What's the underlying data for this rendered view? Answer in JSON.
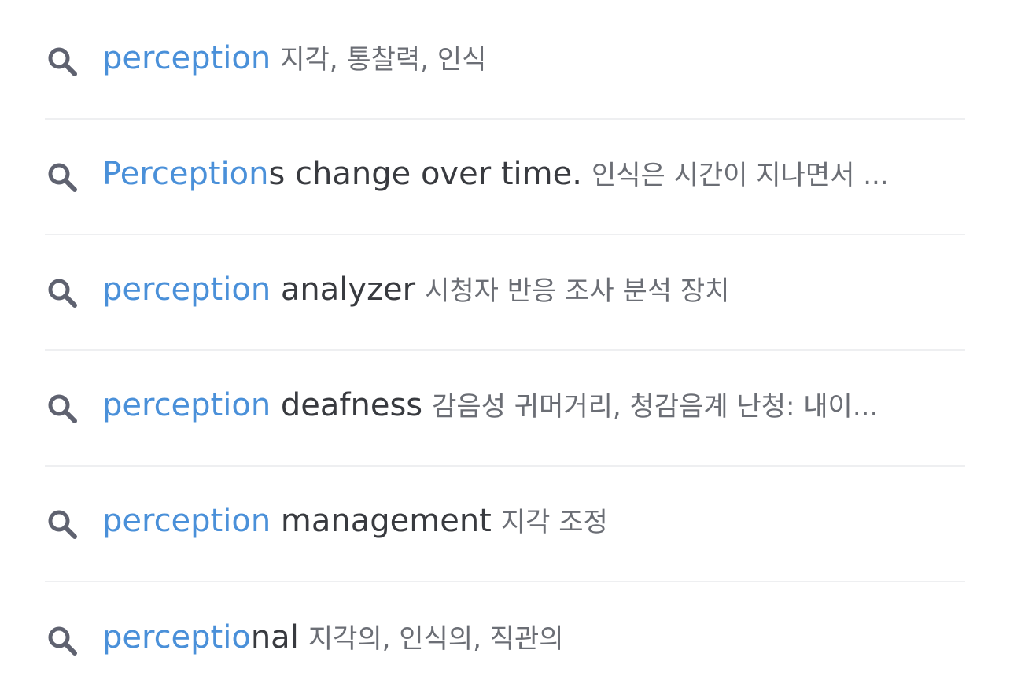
{
  "suggestions": [
    {
      "icon": "search-icon",
      "highlight": "perception",
      "rest": "",
      "definition": "지각, 통찰력, 인식"
    },
    {
      "icon": "search-icon",
      "highlight": "Perception",
      "rest": "s change over time.",
      "definition": "인식은 시간이 지나면서 ..."
    },
    {
      "icon": "search-icon",
      "highlight": "perception",
      "rest": " analyzer",
      "definition": "시청자 반응 조사 분석 장치"
    },
    {
      "icon": "search-icon",
      "highlight": "perception",
      "rest": " deafness",
      "definition": "감음성 귀머거리, 청감음계 난청: 내이..."
    },
    {
      "icon": "search-icon",
      "highlight": "perception",
      "rest": " management",
      "definition": "지각 조정"
    },
    {
      "icon": "search-icon",
      "highlight": "perceptio",
      "rest": "nal",
      "definition": "지각의, 인식의, 직관의"
    }
  ],
  "colors": {
    "highlight": "#4a90d9",
    "text": "#383a3f",
    "definition": "#6b6e75",
    "icon": "#5f6270",
    "divider": "#eeeff1"
  }
}
